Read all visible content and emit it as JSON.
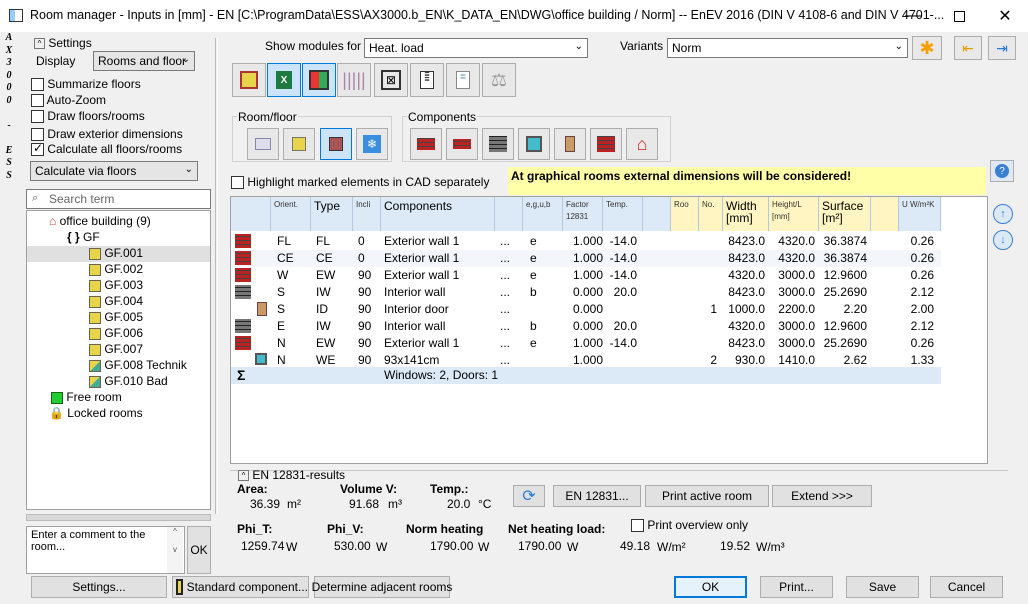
{
  "title": "Room manager - Inputs in [mm] - EN [C:\\ProgramData\\ESS\\AX3000.b_EN\\K_DATA_EN\\DWG\\office building / Norm] -- EnEV 2016 (DIN V 4108-6 and DIN V 4701-...",
  "side_strip": "AX3000 - ESS",
  "settings": {
    "header": "Settings",
    "display_label": "Display",
    "display_value": "Rooms and floor",
    "checks": [
      {
        "label": "Summarize floors",
        "on": false
      },
      {
        "label": "Auto-Zoom",
        "on": false
      },
      {
        "label": "Draw floors/rooms",
        "on": false
      },
      {
        "label": "Draw exterior dimensions",
        "on": false
      },
      {
        "label": "Calculate all floors/rooms",
        "on": true
      }
    ],
    "calc_value": "Calculate via floors",
    "search_placeholder": "Search term"
  },
  "tree": {
    "root": "office building (9)",
    "floor": "GF",
    "rooms": [
      "GF.001",
      "GF.002",
      "GF.003",
      "GF.004",
      "GF.005",
      "GF.006",
      "GF.007",
      "GF.008 Technik",
      "GF.010 Bad"
    ],
    "free_room": "Free room",
    "locked_rooms": "Locked rooms"
  },
  "comment": {
    "placeholder": "Enter a comment to the room...",
    "ok": "OK"
  },
  "toolbar": {
    "show_modules_label": "Show modules for",
    "show_modules_value": "Heat. load",
    "variants_label": "Variants",
    "variants_value": "Norm",
    "room_floor_label": "Room/floor",
    "components_label": "Components"
  },
  "highlight_label": "Highlight marked elements in CAD separately",
  "notice": "At graphical rooms external dimensions will be considered!",
  "grid": {
    "headers": {
      "orient": "Orient.",
      "type": "Type",
      "incl": "Incli",
      "components": "Components",
      "egub": "e,g,u,b",
      "factor": "Factor 12831",
      "temp": "Temp.",
      "roo": "Roo",
      "no": "No.",
      "width": "Width [mm]",
      "height": "Height/L [mm]",
      "surface": "Surface [m²]",
      "u": "U W/m²K"
    },
    "rows": [
      {
        "orient": "FL",
        "type": "FL",
        "incl": "0",
        "comp": "Exterior wall 1",
        "dots": "...",
        "egub": "e",
        "factor": "1.000",
        "temp": "-14.0",
        "no": "",
        "width": "8423.0",
        "height": "4320.0",
        "surface": "36.3874",
        "u": "0.26",
        "icon": "brick-red"
      },
      {
        "orient": "CE",
        "type": "CE",
        "incl": "0",
        "comp": "Exterior wall 1",
        "dots": "...",
        "egub": "e",
        "factor": "1.000",
        "temp": "-14.0",
        "no": "",
        "width": "8423.0",
        "height": "4320.0",
        "surface": "36.3874",
        "u": "0.26",
        "icon": "brick-red"
      },
      {
        "orient": "W",
        "type": "EW",
        "incl": "90",
        "comp": "Exterior wall 1",
        "dots": "...",
        "egub": "e",
        "factor": "1.000",
        "temp": "-14.0",
        "no": "",
        "width": "4320.0",
        "height": "3000.0",
        "surface": "12.9600",
        "u": "0.26",
        "icon": "brick-red"
      },
      {
        "orient": "S",
        "type": "IW",
        "incl": "90",
        "comp": "Interior wall",
        "dots": "...",
        "egub": "b",
        "factor": "0.000",
        "temp": "20.0",
        "no": "",
        "width": "8423.0",
        "height": "3000.0",
        "surface": "25.2690",
        "u": "2.12",
        "icon": "brick-gray"
      },
      {
        "orient": "S",
        "type": "ID",
        "incl": "90",
        "comp": "Interior door",
        "dots": "...",
        "egub": "",
        "factor": "0.000",
        "temp": "",
        "no": "1",
        "width": "1000.0",
        "height": "2200.0",
        "surface": "2.20",
        "u": "2.00",
        "icon": "door"
      },
      {
        "orient": "E",
        "type": "IW",
        "incl": "90",
        "comp": "Interior wall",
        "dots": "...",
        "egub": "b",
        "factor": "0.000",
        "temp": "20.0",
        "no": "",
        "width": "4320.0",
        "height": "3000.0",
        "surface": "12.9600",
        "u": "2.12",
        "icon": "brick-gray"
      },
      {
        "orient": "N",
        "type": "EW",
        "incl": "90",
        "comp": "Exterior wall 1",
        "dots": "...",
        "egub": "e",
        "factor": "1.000",
        "temp": "-14.0",
        "no": "",
        "width": "8423.0",
        "height": "3000.0",
        "surface": "25.2690",
        "u": "0.26",
        "icon": "brick-red"
      },
      {
        "orient": "N",
        "type": "WE",
        "incl": "90",
        "comp": "93x141cm",
        "dots": "...",
        "egub": "",
        "factor": "1.000",
        "temp": "",
        "no": "2",
        "width": "930.0",
        "height": "1410.0",
        "surface": "2.62",
        "u": "1.33",
        "icon": "window"
      }
    ],
    "sum_symbol": "Σ",
    "sum_text": "Windows: 2, Doors: 1"
  },
  "results": {
    "header": "EN 12831-results",
    "area_label": "Area:",
    "area_value": "36.39",
    "area_unit": "m²",
    "volume_label": "Volume V:",
    "volume_value": "91.68",
    "volume_unit": "m³",
    "temp_label": "Temp.:",
    "temp_value": "20.0",
    "temp_unit": "°C",
    "en_button": "EN 12831...",
    "print_active": "Print active room",
    "extend": "Extend >>>",
    "phi_t_label": "Phi_T:",
    "phi_t_value": "1259.74",
    "phi_t_unit": "W",
    "phi_v_label": "Phi_V:",
    "phi_v_value": "530.00",
    "phi_v_unit": "W",
    "norm_label": "Norm heating",
    "norm_value": "1790.00",
    "norm_unit": "W",
    "net_label": "Net heating load:",
    "net_value": "1790.00",
    "net_unit": "W",
    "wm2_1": "49.18",
    "wm2_1_unit": "W/m²",
    "wm3": "19.52",
    "wm3_unit": "W/m³",
    "print_overview": "Print overview only"
  },
  "footer": {
    "settings": "Settings...",
    "standard": "Standard component...",
    "adjacent": "Determine adjacent rooms",
    "ok": "OK",
    "print": "Print...",
    "save": "Save",
    "cancel": "Cancel"
  }
}
